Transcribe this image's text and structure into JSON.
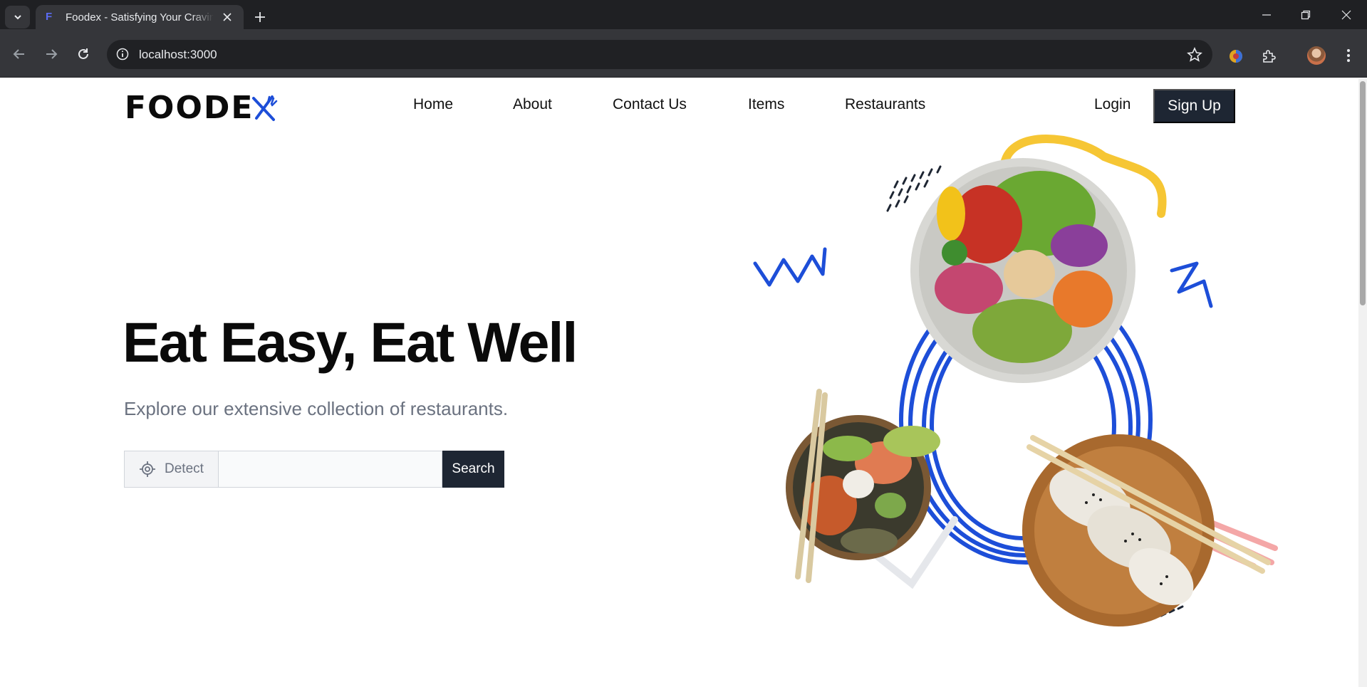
{
  "browser": {
    "tab_title": "Foodex - Satisfying Your Cravings",
    "tab_favicon": "F",
    "url": "localhost:3000",
    "icons": [
      "tab-search-icon",
      "close-icon",
      "new-tab-icon",
      "minimize-icon",
      "restore-icon",
      "window-close-icon",
      "back-icon",
      "forward-icon",
      "reload-icon",
      "site-info-icon",
      "bookmark-star-icon",
      "extension-icon",
      "puzzle-icon",
      "menu-icon"
    ]
  },
  "site": {
    "logo_text": "FOODE",
    "nav": [
      {
        "label": "Home"
      },
      {
        "label": "About"
      },
      {
        "label": "Contact Us"
      },
      {
        "label": "Items"
      },
      {
        "label": "Restaurants"
      }
    ],
    "login_label": "Login",
    "signup_label": "Sign Up"
  },
  "hero": {
    "title": "Eat Easy, Eat Well",
    "subtitle": "Explore our extensive collection of restaurants.",
    "detect_label": "Detect",
    "search_value": "",
    "search_button": "Search"
  },
  "colors": {
    "accent_blue": "#1d4ed8",
    "dark_navy": "#1e2633",
    "yellow_swirl": "#f6c634",
    "pink_stroke": "#f4a7a7"
  }
}
